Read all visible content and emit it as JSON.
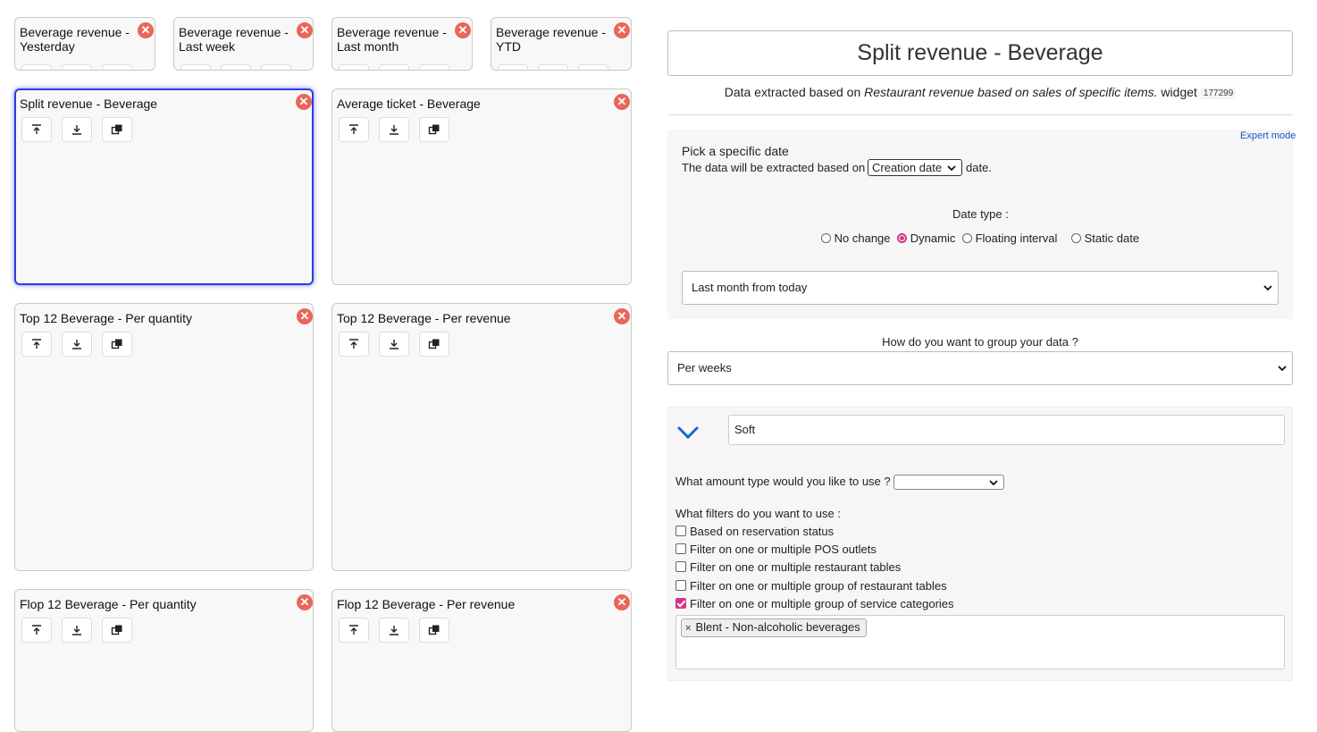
{
  "widgets": [
    {
      "title": "Beverage revenue - Yesterday"
    },
    {
      "title": "Beverage revenue - Last week"
    },
    {
      "title": "Beverage revenue - Last month"
    },
    {
      "title": "Beverage revenue - YTD"
    },
    {
      "title": "Split revenue - Beverage"
    },
    {
      "title": "Average ticket - Beverage"
    },
    {
      "title": "Top 12 Beverage - Per quantity"
    },
    {
      "title": "Top 12 Beverage - Per revenue"
    },
    {
      "title": "Flop 12 Beverage - Per quantity"
    },
    {
      "title": "Flop 12 Beverage - Per revenue"
    }
  ],
  "icons": {
    "close": "close-icon",
    "move_top": "move-top-icon",
    "move_bottom": "move-bottom-icon",
    "duplicate": "duplicate-icon"
  },
  "close_glyph": "✕",
  "panel": {
    "title": "Split revenue - Beverage",
    "extract_prefix": "Data extracted based on ",
    "extract_source": "Restaurant revenue based on sales of specific items.",
    "extract_suffix": " widget",
    "widget_id": "177299",
    "expert_mode": "Expert mode",
    "date": {
      "heading": "Pick a specific date",
      "basis_prefix": "The data will be extracted based on",
      "basis_value": "Creation date",
      "basis_suffix": "date.",
      "type_label": "Date type :",
      "options": [
        "No change",
        "Dynamic",
        "Floating interval",
        "Static date"
      ],
      "selected": "Dynamic",
      "dynamic_value": "Last month from today"
    },
    "group": {
      "label": "How do you want to group your data ?",
      "value": "Per weeks"
    },
    "sub": {
      "name_value": "Soft",
      "amount_label": "What amount type would you like to use ?",
      "amount_value": "",
      "filters_label": "What filters do you want to use :",
      "filters": [
        {
          "label": "Based on reservation status",
          "checked": false
        },
        {
          "label": "Filter on one or multiple POS outlets",
          "checked": false
        },
        {
          "label": "Filter on one or multiple restaurant tables",
          "checked": false
        },
        {
          "label": "Filter on one or multiple group of restaurant tables",
          "checked": false
        },
        {
          "label": "Filter on one or multiple group of service categories",
          "checked": true
        }
      ],
      "selected_tag": "Blent - Non-alcoholic beverages",
      "tag_remove": "×"
    }
  }
}
